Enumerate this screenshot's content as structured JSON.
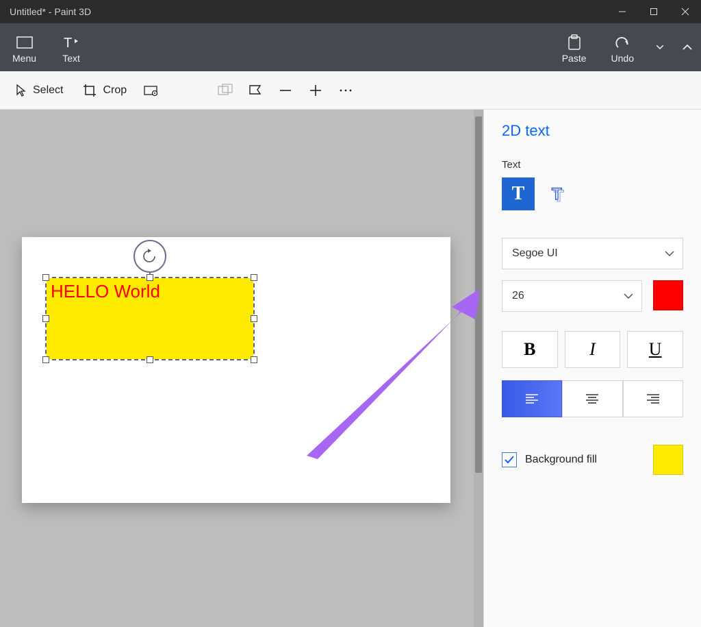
{
  "titlebar": {
    "title": "Untitled* - Paint 3D"
  },
  "ribbon": {
    "menu": "Menu",
    "text": "Text",
    "paste": "Paste",
    "undo": "Undo"
  },
  "toolbar": {
    "select": "Select",
    "crop": "Crop"
  },
  "canvas": {
    "text_content": "HELLO World",
    "text_color": "#ff0000",
    "text_bg": "#ffeb00"
  },
  "panel": {
    "title": "2D text",
    "text_label": "Text",
    "font_family": "Segoe UI",
    "font_size": "26",
    "text_color": "#ff0000",
    "bold": "B",
    "italic": "I",
    "underline": "U",
    "bg_fill_label": "Background fill",
    "bg_fill_checked": true,
    "bg_fill_color": "#ffeb00"
  }
}
